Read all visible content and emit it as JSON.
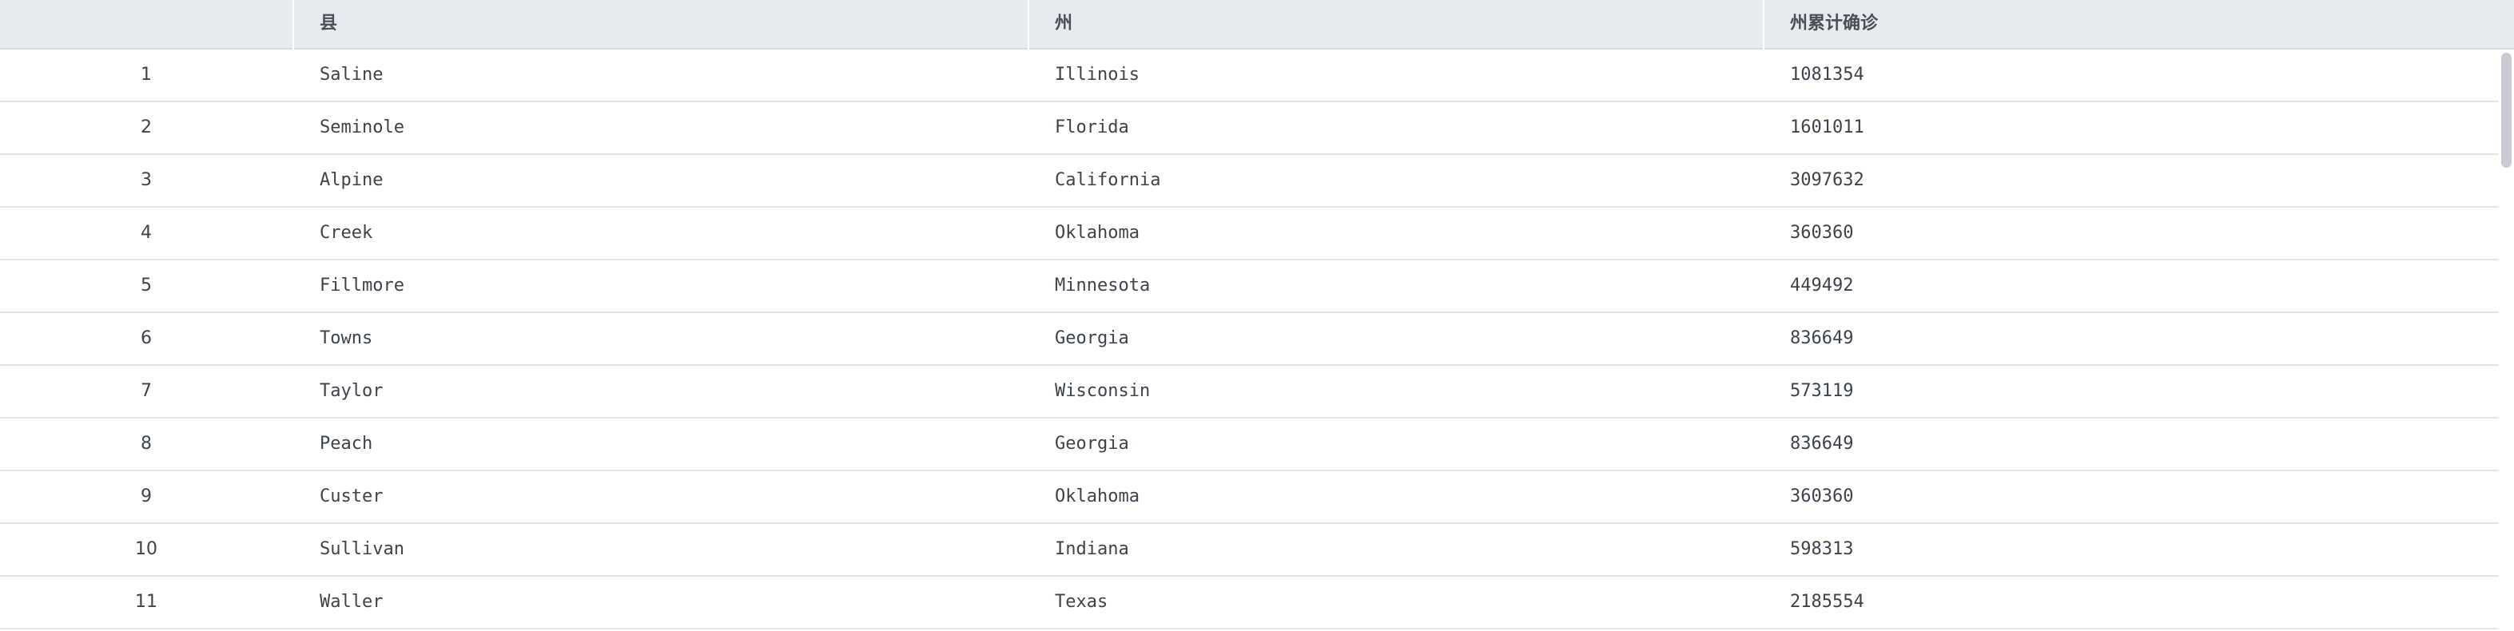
{
  "table": {
    "columns": [
      "",
      "县",
      "州",
      "州累计确诊"
    ],
    "rows": [
      {
        "index": "1",
        "county": "Saline",
        "state": "Illinois",
        "cases": "1081354"
      },
      {
        "index": "2",
        "county": "Seminole",
        "state": "Florida",
        "cases": "1601011"
      },
      {
        "index": "3",
        "county": "Alpine",
        "state": "California",
        "cases": "3097632"
      },
      {
        "index": "4",
        "county": "Creek",
        "state": "Oklahoma",
        "cases": "360360"
      },
      {
        "index": "5",
        "county": "Fillmore",
        "state": "Minnesota",
        "cases": "449492"
      },
      {
        "index": "6",
        "county": "Towns",
        "state": "Georgia",
        "cases": "836649"
      },
      {
        "index": "7",
        "county": "Taylor",
        "state": "Wisconsin",
        "cases": "573119"
      },
      {
        "index": "8",
        "county": "Peach",
        "state": "Georgia",
        "cases": "836649"
      },
      {
        "index": "9",
        "county": "Custer",
        "state": "Oklahoma",
        "cases": "360360"
      },
      {
        "index": "10",
        "county": "Sullivan",
        "state": "Indiana",
        "cases": "598313"
      },
      {
        "index": "11",
        "county": "Waller",
        "state": "Texas",
        "cases": "2185554"
      }
    ]
  },
  "colors": {
    "header_bg": "#e7ebf0",
    "row_border": "#e2e5e9",
    "text": "#3d434c",
    "scroll_thumb": "#c8cbd0"
  }
}
